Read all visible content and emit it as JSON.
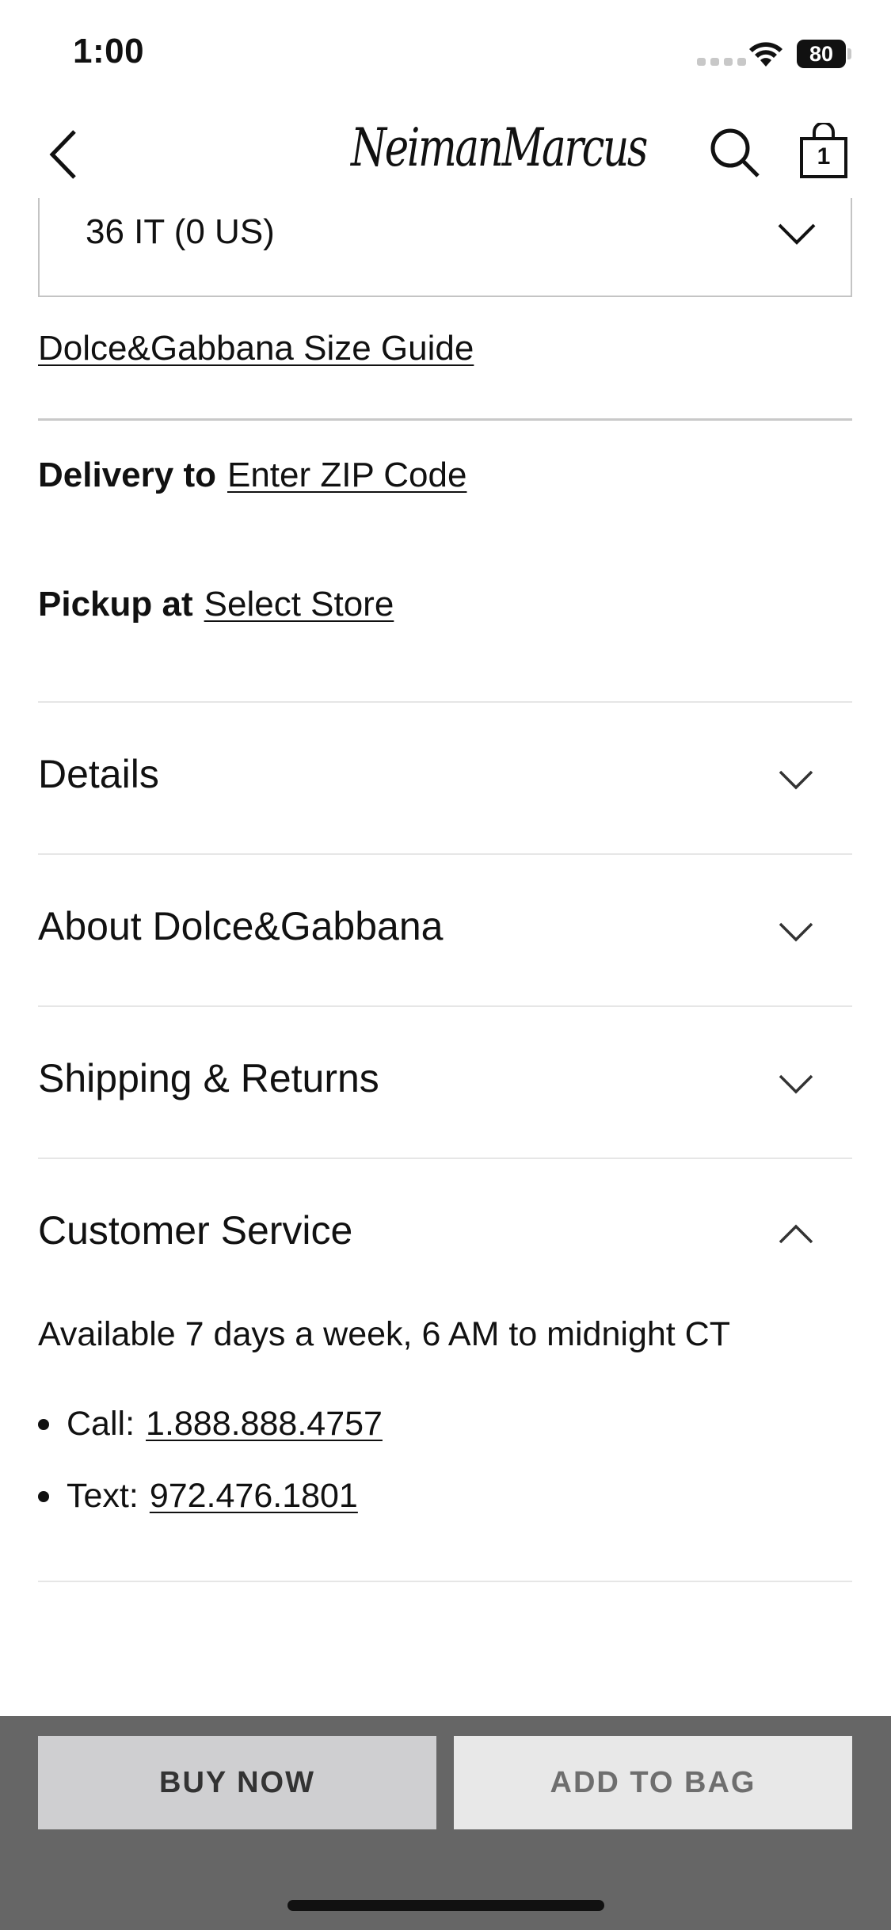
{
  "status_bar": {
    "time": "1:00",
    "battery": "80"
  },
  "header": {
    "logo": "NeimanMarcus",
    "bag_count": "1"
  },
  "size_select": {
    "value": "36 IT (0 US)"
  },
  "size_guide": "Dolce&Gabbana Size Guide",
  "delivery": {
    "label": "Delivery to",
    "link": "Enter ZIP Code"
  },
  "pickup": {
    "label": "Pickup at",
    "link": "Select Store"
  },
  "accordions": [
    {
      "title": "Details",
      "expanded": false
    },
    {
      "title": "About Dolce&Gabbana",
      "expanded": false
    },
    {
      "title": "Shipping & Returns",
      "expanded": false
    },
    {
      "title": "Customer Service",
      "expanded": true
    }
  ],
  "customer_service": {
    "availability": "Available 7 days a week, 6 AM to midnight CT",
    "call_label": "Call:",
    "call_number": "1.888.888.4757",
    "text_label": "Text:",
    "text_number": "972.476.1801"
  },
  "actions": {
    "buy_now": "BUY NOW",
    "add_to_bag": "ADD TO BAG"
  }
}
